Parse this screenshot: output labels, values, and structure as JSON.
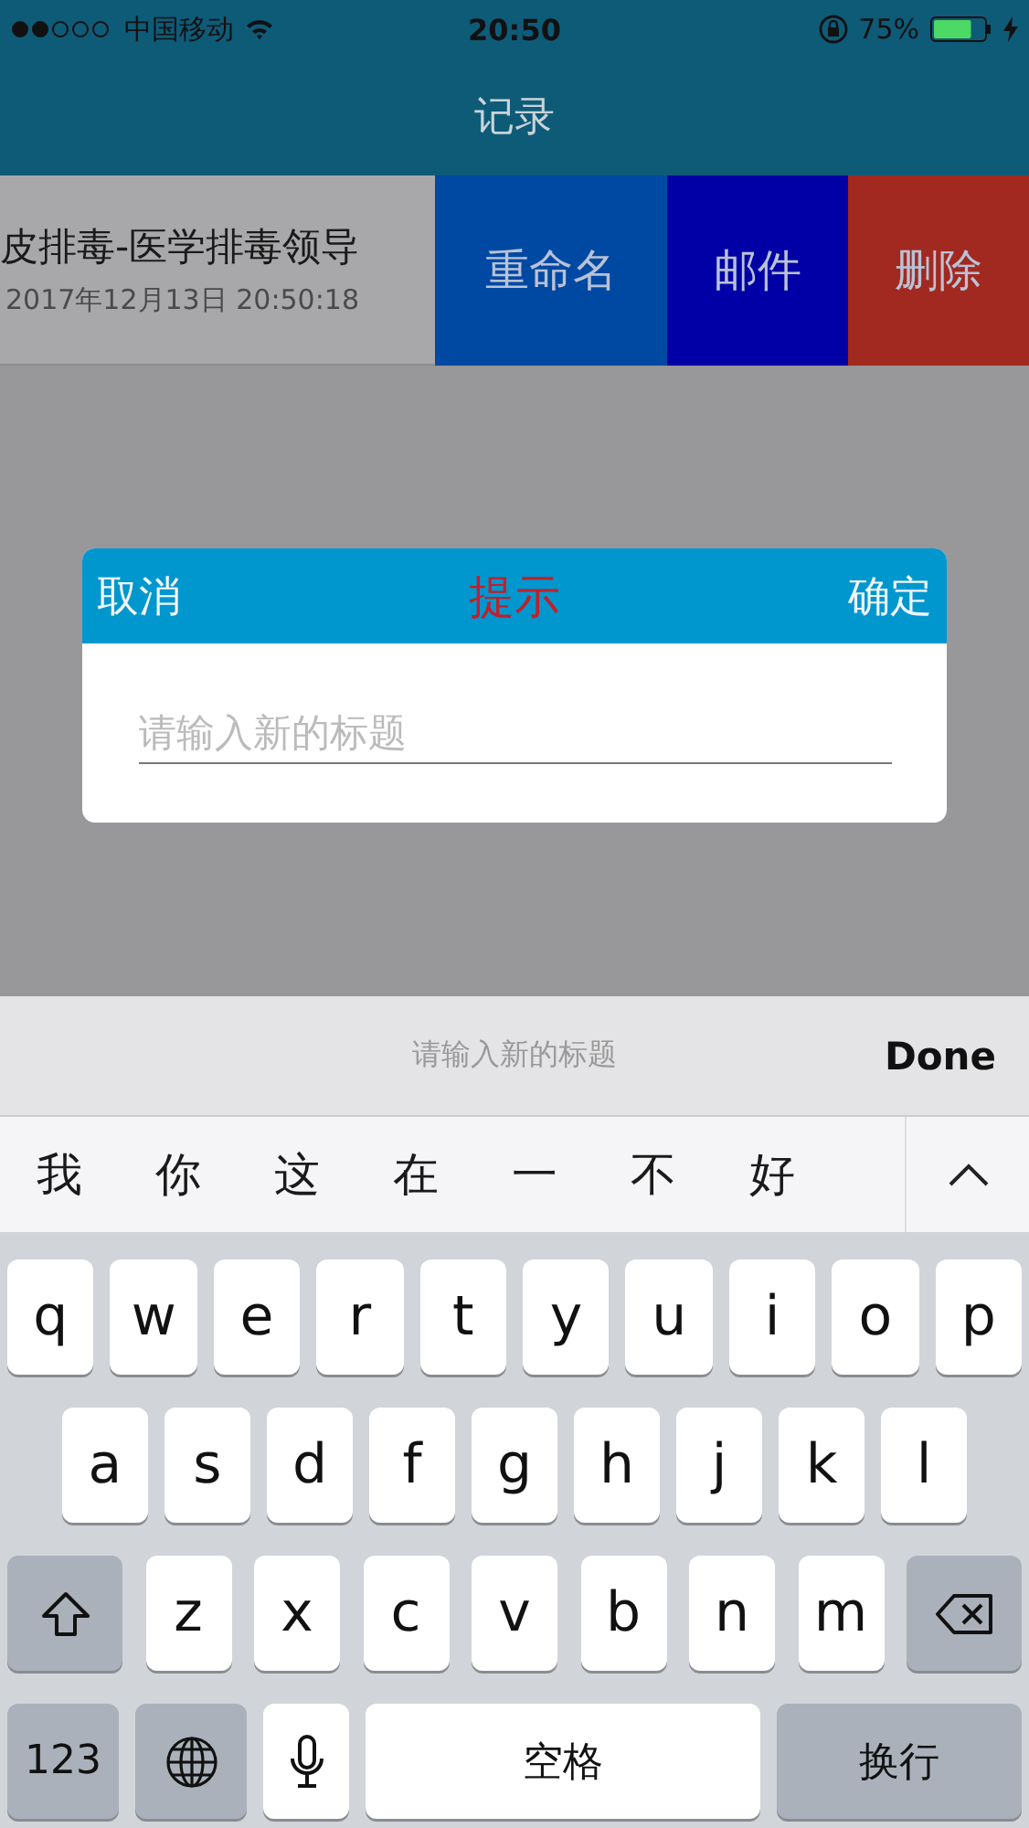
{
  "status_bar": {
    "carrier": "中国移动",
    "time": "20:50",
    "battery_percent": "75%",
    "battery": {
      "level": 0.75
    }
  },
  "nav_bar": {
    "title": "记录"
  },
  "record_row": {
    "title": "皮排毒-医学排毒领导",
    "date": "2017年12月13日 20:50:18",
    "actions": [
      {
        "label": "重命名",
        "color": "#0049a3"
      },
      {
        "label": "邮件",
        "color": "#0000a6"
      },
      {
        "label": "删除",
        "color": "#a12920"
      }
    ]
  },
  "dialog": {
    "cancel": "取消",
    "title": "提示",
    "confirm": "确定",
    "input": {
      "placeholder": "请输入新的标题"
    }
  },
  "keyboard": {
    "toolbar": {
      "hint": "请输入新的标题",
      "done": "Done"
    },
    "candidates": [
      "我",
      "你",
      "这",
      "在",
      "一",
      "不",
      "好"
    ],
    "key_rows": {
      "top": [
        {
          "kind": "letter",
          "label": "q"
        },
        {
          "kind": "letter",
          "label": "w"
        },
        {
          "kind": "letter",
          "label": "e"
        },
        {
          "kind": "letter",
          "label": "r"
        },
        {
          "kind": "letter",
          "label": "t"
        },
        {
          "kind": "letter",
          "label": "y"
        },
        {
          "kind": "letter",
          "label": "u"
        },
        {
          "kind": "letter",
          "label": "i"
        },
        {
          "kind": "letter",
          "label": "o"
        },
        {
          "kind": "letter",
          "label": "p"
        }
      ],
      "middle": [
        {
          "kind": "letter",
          "label": "a"
        },
        {
          "kind": "letter",
          "label": "s"
        },
        {
          "kind": "letter",
          "label": "d"
        },
        {
          "kind": "letter",
          "label": "f"
        },
        {
          "kind": "letter",
          "label": "g"
        },
        {
          "kind": "letter",
          "label": "h"
        },
        {
          "kind": "letter",
          "label": "j"
        },
        {
          "kind": "letter",
          "label": "k"
        },
        {
          "kind": "letter",
          "label": "l"
        }
      ],
      "lower": [
        {
          "kind": "shift"
        },
        {
          "kind": "letter",
          "label": "z"
        },
        {
          "kind": "letter",
          "label": "x"
        },
        {
          "kind": "letter",
          "label": "c"
        },
        {
          "kind": "letter",
          "label": "v"
        },
        {
          "kind": "letter",
          "label": "b"
        },
        {
          "kind": "letter",
          "label": "n"
        },
        {
          "kind": "letter",
          "label": "m"
        },
        {
          "kind": "delete"
        }
      ],
      "bottom": [
        {
          "kind": "numbers",
          "label": "123"
        },
        {
          "kind": "globe"
        },
        {
          "kind": "mic"
        },
        {
          "kind": "space",
          "label": "空格"
        },
        {
          "kind": "return",
          "label": "换行"
        }
      ]
    }
  }
}
